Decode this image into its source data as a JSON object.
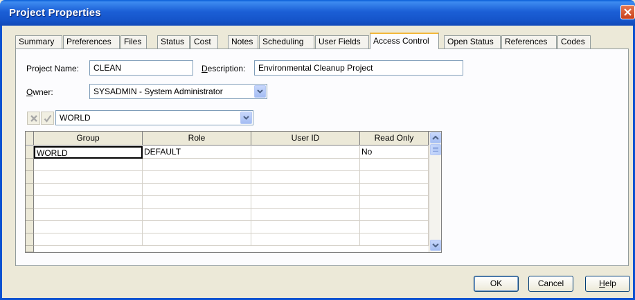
{
  "window": {
    "title": "Project Properties"
  },
  "tabs": [
    {
      "label": "Summary"
    },
    {
      "label": "Preferences"
    },
    {
      "label": "Files"
    },
    {
      "label": "Status"
    },
    {
      "label": "Cost"
    },
    {
      "label": "Notes"
    },
    {
      "label": "Scheduling"
    },
    {
      "label": "User Fields"
    },
    {
      "label": "Access Control",
      "active": true
    },
    {
      "label": "Open Status"
    },
    {
      "label": "References"
    },
    {
      "label": "Codes"
    }
  ],
  "form": {
    "project_name_label": "Project Name:",
    "project_name_value": "CLEAN",
    "description_label_first": "D",
    "description_label_rest": "escription:",
    "description_value": "Environmental Cleanup Project",
    "owner_label_first": "O",
    "owner_label_rest": "wner:",
    "owner_value": "SYSADMIN - System Administrator"
  },
  "access": {
    "selected_group": "WORLD",
    "columns": [
      "Group",
      "Role",
      "User ID",
      "Read Only"
    ],
    "rows": [
      {
        "group": "WORLD",
        "role": "DEFAULT",
        "user_id": "",
        "read_only": "No"
      }
    ]
  },
  "buttons": {
    "ok": "OK",
    "cancel": "Cancel",
    "help_first": "H",
    "help_rest": "elp"
  }
}
